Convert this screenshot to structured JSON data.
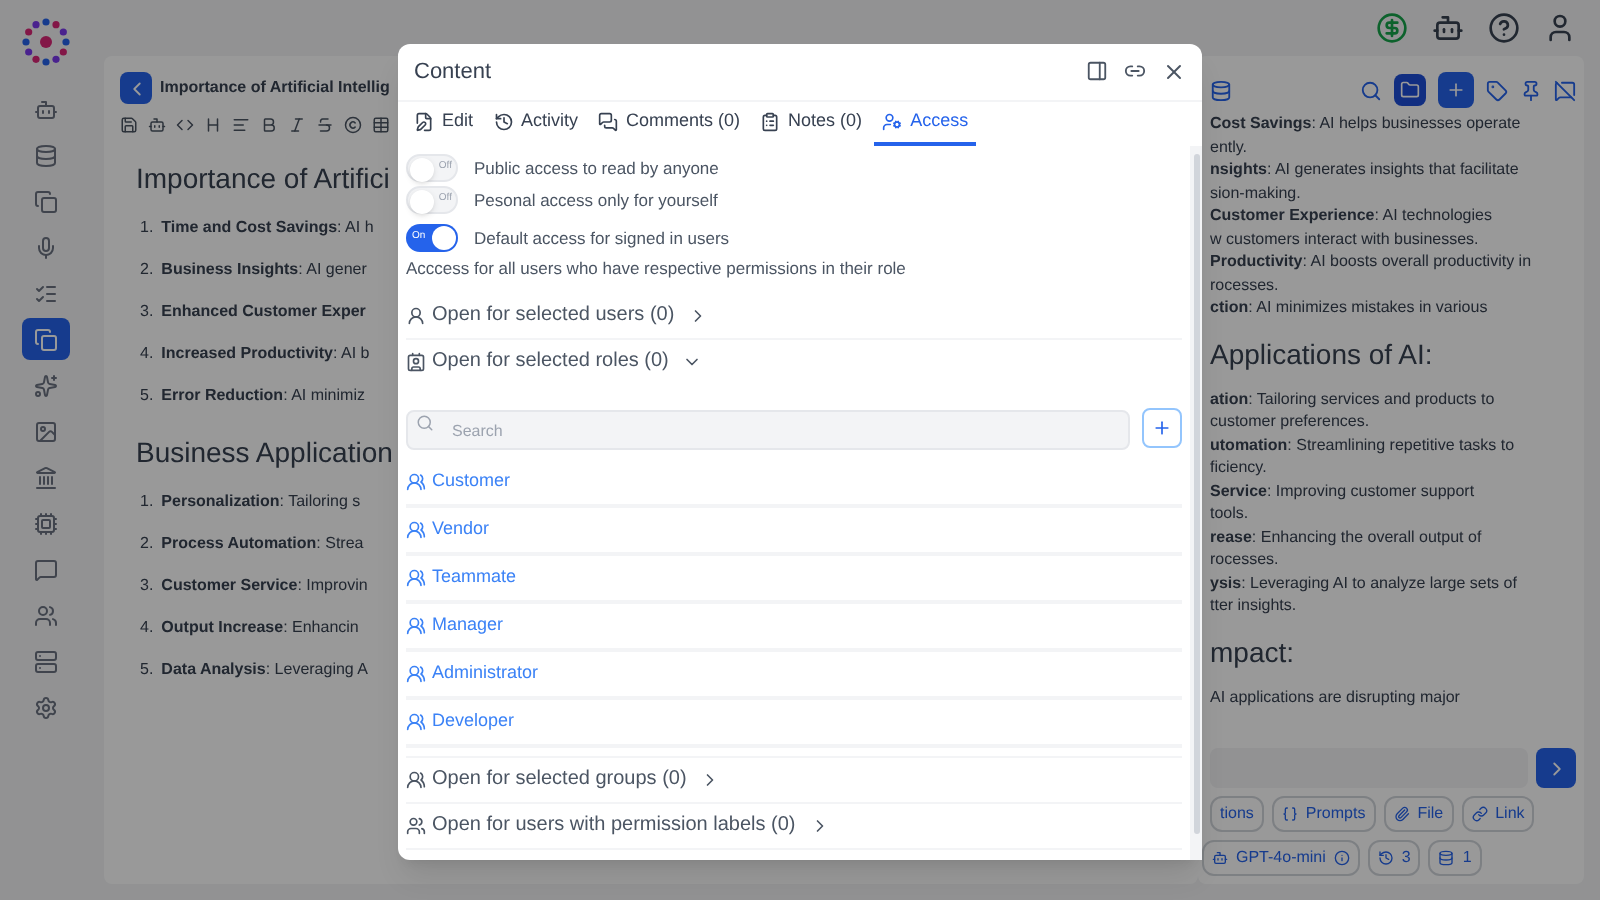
{
  "sidebar": {
    "items": [
      {
        "selected": false
      },
      {
        "selected": false
      },
      {
        "selected": false
      },
      {
        "selected": false
      },
      {
        "selected": false
      },
      {
        "selected": true
      },
      {
        "selected": false
      },
      {
        "selected": false
      },
      {
        "selected": false
      },
      {
        "selected": false
      },
      {
        "selected": false
      },
      {
        "selected": false
      },
      {
        "selected": false
      },
      {
        "selected": false
      }
    ]
  },
  "editor": {
    "title": "Importance of Artificial Intellig",
    "sections": [
      {
        "heading": "Importance of Artifici",
        "items": [
          {
            "number": "1.",
            "text": "**Time and Cost Savings**: AI h"
          },
          {
            "number": "2.",
            "text": "**Business Insights**: AI gener"
          },
          {
            "number": "3.",
            "text": "**Enhanced Customer Exper**"
          },
          {
            "number": "4.",
            "text": "**Increased Productivity**: AI b"
          },
          {
            "number": "5.",
            "text": "**Error Reduction**: AI minimiz"
          }
        ]
      },
      {
        "heading": "Business Application",
        "items": [
          {
            "number": "1.",
            "text": "**Personalization**: Tailoring s"
          },
          {
            "number": "2.",
            "text": "**Process Automation**: Strea"
          },
          {
            "number": "3.",
            "text": "**Customer Service**: Improvin"
          },
          {
            "number": "4.",
            "text": "**Output Increase**: Enhancin"
          },
          {
            "number": "5.",
            "text": "**Data Analysis**: Leveraging A"
          }
        ]
      }
    ]
  },
  "chat_panel": {
    "lines": [
      {
        "kind": "text",
        "text": "**Cost Savings**: AI helps businesses operate"
      },
      {
        "kind": "text",
        "text": "ently."
      },
      {
        "kind": "text",
        "text": "**nsights**: AI generates insights that facilitate"
      },
      {
        "kind": "text",
        "text": "sion-making."
      },
      {
        "kind": "text",
        "text": "**Customer Experience**: AI technologies"
      },
      {
        "kind": "text",
        "text": "w customers interact with businesses."
      },
      {
        "kind": "text",
        "text": "**Productivity**: AI boosts overall productivity in"
      },
      {
        "kind": "text",
        "text": "rocesses."
      },
      {
        "kind": "text",
        "text": "**ction**: AI minimizes mistakes in various"
      },
      {
        "kind": "heading",
        "text": "Applications of AI:"
      },
      {
        "kind": "text",
        "text": "**ation**: Tailoring services and products to"
      },
      {
        "kind": "text",
        "text": "customer preferences."
      },
      {
        "kind": "text",
        "text": "**utomation**: Streamlining repetitive tasks to"
      },
      {
        "kind": "text",
        "text": "ficiency."
      },
      {
        "kind": "text",
        "text": "**Service**: Improving customer support"
      },
      {
        "kind": "text",
        "text": "tools."
      },
      {
        "kind": "text",
        "text": "**rease**: Enhancing the overall output of"
      },
      {
        "kind": "text",
        "text": "rocesses."
      },
      {
        "kind": "text",
        "text": "**ysis**: Leveraging AI to analyze large sets of"
      },
      {
        "kind": "text",
        "text": "tter insights."
      },
      {
        "kind": "heading",
        "text": "mpact:"
      },
      {
        "kind": "text",
        "text": "AI applications are disrupting major"
      }
    ],
    "chips": [
      {
        "kind": "plain",
        "label": "tions"
      },
      {
        "kind": "prompts",
        "label": "Prompts"
      },
      {
        "kind": "file",
        "label": "File"
      },
      {
        "kind": "link",
        "label": "Link"
      }
    ],
    "model": "GPT-4o-mini",
    "history_count": "3",
    "database_count": "1"
  },
  "dialog": {
    "title": "Content",
    "tabs": [
      {
        "kind": "edit",
        "label": "Edit",
        "selected": false
      },
      {
        "kind": "activity",
        "label": "Activity",
        "selected": false
      },
      {
        "kind": "comments",
        "label": "Comments (0)",
        "selected": false
      },
      {
        "kind": "notes",
        "label": "Notes (0)",
        "selected": false
      },
      {
        "kind": "access",
        "label": "Access",
        "selected": true
      }
    ],
    "toggles": [
      {
        "label": "Public access to read by anyone",
        "on": false,
        "switch_text": "Off"
      },
      {
        "label": "Pesonal access only for yourself",
        "on": false,
        "switch_text": "Off"
      },
      {
        "label": "Default access for signed in users",
        "on": true,
        "switch_text": "On"
      }
    ],
    "note": "Acccess for all users who have respective permissions in their role",
    "sections": [
      {
        "kind": "users",
        "label": "Open for selected users (0)",
        "expanded": false
      },
      {
        "kind": "roles",
        "label": "Open for selected roles (0)",
        "expanded": true,
        "search": {
          "placeholder": "Search"
        },
        "roles": [
          "Customer",
          "Vendor",
          "Teammate",
          "Manager",
          "Administrator",
          "Developer"
        ]
      },
      {
        "kind": "groups",
        "label": "Open for selected groups (0)",
        "expanded": false
      },
      {
        "kind": "labels",
        "label": "Open for users with permission labels (0)",
        "expanded": false
      }
    ]
  }
}
